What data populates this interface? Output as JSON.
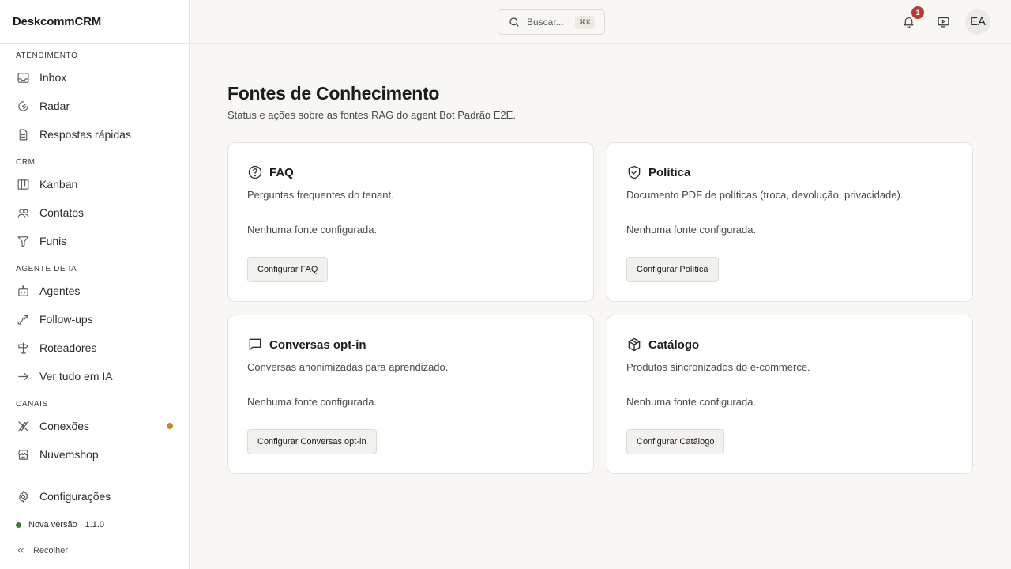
{
  "brand": "DeskcommCRM",
  "sidebar": {
    "sections": [
      {
        "label": "ATENDIMENTO",
        "items": [
          {
            "label": "Inbox",
            "icon": "inbox-icon"
          },
          {
            "label": "Radar",
            "icon": "radar-icon"
          },
          {
            "label": "Respostas rápidas",
            "icon": "document-icon"
          }
        ]
      },
      {
        "label": "CRM",
        "items": [
          {
            "label": "Kanban",
            "icon": "kanban-icon"
          },
          {
            "label": "Contatos",
            "icon": "users-icon"
          },
          {
            "label": "Funis",
            "icon": "funnel-icon"
          }
        ]
      },
      {
        "label": "AGENTE DE IA",
        "items": [
          {
            "label": "Agentes",
            "icon": "bot-icon"
          },
          {
            "label": "Follow-ups",
            "icon": "route-icon"
          },
          {
            "label": "Roteadores",
            "icon": "signpost-icon"
          },
          {
            "label": "Ver tudo em IA",
            "icon": "arrow-right-icon"
          }
        ]
      },
      {
        "label": "CANAIS",
        "items": [
          {
            "label": "Conexões",
            "icon": "plug-icon",
            "status_color": "#c48a2a"
          },
          {
            "label": "Nuvemshop",
            "icon": "store-icon"
          }
        ]
      }
    ],
    "settings_label": "Configurações",
    "version_label": "Nova versão · 1.1.0",
    "collapse_label": "Recolher"
  },
  "topbar": {
    "search_placeholder": "Buscar...",
    "search_shortcut": "⌘K",
    "notification_count": "1",
    "avatar_initials": "EA"
  },
  "main": {
    "title": "Fontes de Conhecimento",
    "subtitle": "Status e ações sobre as fontes RAG do agent Bot Padrão E2E.",
    "cards": [
      {
        "title": "FAQ",
        "icon": "help-circle-icon",
        "description": "Perguntas frequentes do tenant.",
        "status": "Nenhuma fonte configurada.",
        "button": "Configurar FAQ"
      },
      {
        "title": "Política",
        "icon": "shield-check-icon",
        "description": "Documento PDF de políticas (troca, devolução, privacidade).",
        "status": "Nenhuma fonte configurada.",
        "button": "Configurar Política"
      },
      {
        "title": "Conversas opt-in",
        "icon": "message-square-icon",
        "description": "Conversas anonimizadas para aprendizado.",
        "status": "Nenhuma fonte configurada.",
        "button": "Configurar Conversas opt-in"
      },
      {
        "title": "Catálogo",
        "icon": "package-icon",
        "description": "Produtos sincronizados do e-commerce.",
        "status": "Nenhuma fonte configurada.",
        "button": "Configurar Catálogo"
      }
    ]
  },
  "colors": {
    "accent_warning": "#c48a2a",
    "badge": "#b83a33",
    "online": "#3f7a3a"
  }
}
